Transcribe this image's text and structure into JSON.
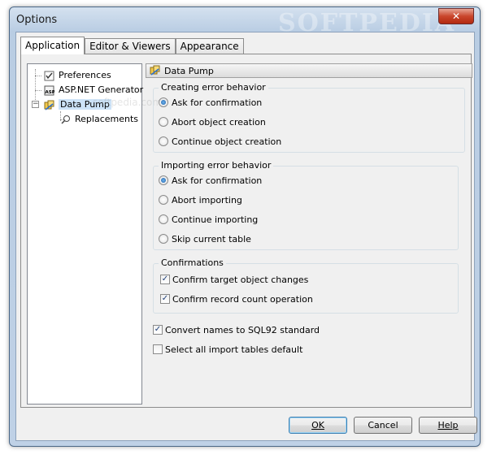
{
  "window": {
    "title": "Options",
    "watermark": "SOFTPEDIA",
    "close_label": "✕"
  },
  "tabs": [
    {
      "label": "Application",
      "active": true
    },
    {
      "label": "Editor & Viewers",
      "active": false
    },
    {
      "label": "Appearance",
      "active": false
    }
  ],
  "tree": {
    "items": [
      {
        "label": "Preferences",
        "icon": "preferences-icon"
      },
      {
        "label": "ASP.NET Generator",
        "icon": "asp-icon"
      },
      {
        "label": "Data Pump",
        "icon": "data-pump-icon",
        "selected": true
      },
      {
        "label": "Replacements",
        "icon": "replacements-icon"
      }
    ],
    "watermark": "softpedia.com"
  },
  "header": {
    "title": "Data Pump"
  },
  "creating": {
    "title": "Creating error behavior",
    "options": [
      "Ask for confirmation",
      "Abort object creation",
      "Continue object creation"
    ],
    "selected": 0
  },
  "importing": {
    "title": "Importing error behavior",
    "options": [
      "Ask for confirmation",
      "Abort importing",
      "Continue importing",
      "Skip current table"
    ],
    "selected": 0
  },
  "confirmations": {
    "title": "Confirmations",
    "options": [
      {
        "label": "Confirm target object changes",
        "checked": true
      },
      {
        "label": "Confirm record count operation",
        "checked": true
      }
    ]
  },
  "standalone": [
    {
      "label": "Convert names to SQL92 standard",
      "checked": true
    },
    {
      "label": "Select all import tables default",
      "checked": false
    }
  ],
  "buttons": {
    "ok": "OK",
    "cancel": "Cancel",
    "help": "Help"
  },
  "colors": {
    "accent": "#3c7fb1",
    "selection": "#cde3f8",
    "window_frame": "#bfd1e6"
  }
}
